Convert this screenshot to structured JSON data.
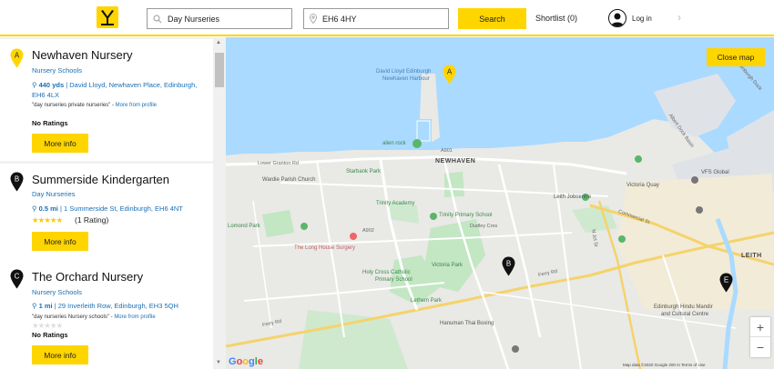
{
  "header": {
    "search_what": "Day Nurseries",
    "search_where": "EH6 4HY",
    "search_button": "Search",
    "shortlist": "Shortlist (0)",
    "login": "Log in",
    "next_arrow": "›"
  },
  "listings": [
    {
      "marker": "A",
      "name": "Newhaven Nursery",
      "category": "Nursery Schools",
      "distance": "440 yds",
      "address": "David Lloyd, Newhaven Place, Edinburgh, EH6 4LX",
      "description": "\"day nurseries private nurseries\"",
      "more_from_profile": "More from profile",
      "rating": "No Ratings",
      "button": "More info"
    },
    {
      "marker": "B",
      "name": "Summerside Kindergarten",
      "category": "Day Nurseries",
      "distance": "0.5 mi",
      "address": "1 Summerside St, Edinburgh, EH6 4NT",
      "stars": "★★★★★",
      "rating_count": "(1 Rating)",
      "button": "More info"
    },
    {
      "marker": "C",
      "name": "The Orchard Nursery",
      "category": "Nursery Schools",
      "distance": "1 mi",
      "address": "29 Inverleith Row, Edinburgh, EH3 5QH",
      "description": "\"day nurseries Nursery schools\"",
      "more_from_profile": "More from profile",
      "stars_empty": "★★★★★",
      "rating": "No Ratings",
      "button": "More info"
    }
  ],
  "map": {
    "close_button": "Close map",
    "zoom_in": "+",
    "zoom_out": "−",
    "markers": [
      "A",
      "B",
      "E"
    ],
    "google": [
      "G",
      "o",
      "o",
      "g",
      "l",
      "e"
    ],
    "attribution": "Map data ©2020 Google   200 m    Terms of Use",
    "labels": {
      "david_lloyd": "David Lloyd Edinburgh",
      "newhaven_harbour": "Newhaven Harbour",
      "alien_rock": "alien rock",
      "newhaven": "NEWHAVEN",
      "lower_granton": "Lower Granton Rd",
      "starbank": "Starbank Park",
      "wardie": "Wardie Parish Church",
      "leith_jobcentre": "Leith Jobcentre",
      "victoria_quay": "Victoria Quay",
      "vfs": "VFS Global",
      "lomond": "Lomond Park",
      "trinity_academy": "Trinity Academy",
      "trinity_primary": "Trinity Primary School",
      "long_house": "The Long House Surgery",
      "commercial": "Commercial St",
      "victoria_park": "Victoria Park",
      "holy_cross": "Holy Cross Catholic",
      "primary_school": "Primary School",
      "lethem": "Lethem Park",
      "ferry_rd": "Ferry Rd",
      "ferry_rd2": "Ferry Rd",
      "leith": "LEITH",
      "hindu": "Edinburgh Hindu Mandir",
      "cultural": "and Cultural Centre",
      "hanuman": "Hanuman Thai Boxing",
      "a901": "A901",
      "a902": "A902",
      "dudley": "Dudley Cres",
      "n_jct": "N Jct St",
      "albert_dock": "Albert Dock Basin",
      "edinburgh_dock": "Edinburgh Dock"
    }
  }
}
